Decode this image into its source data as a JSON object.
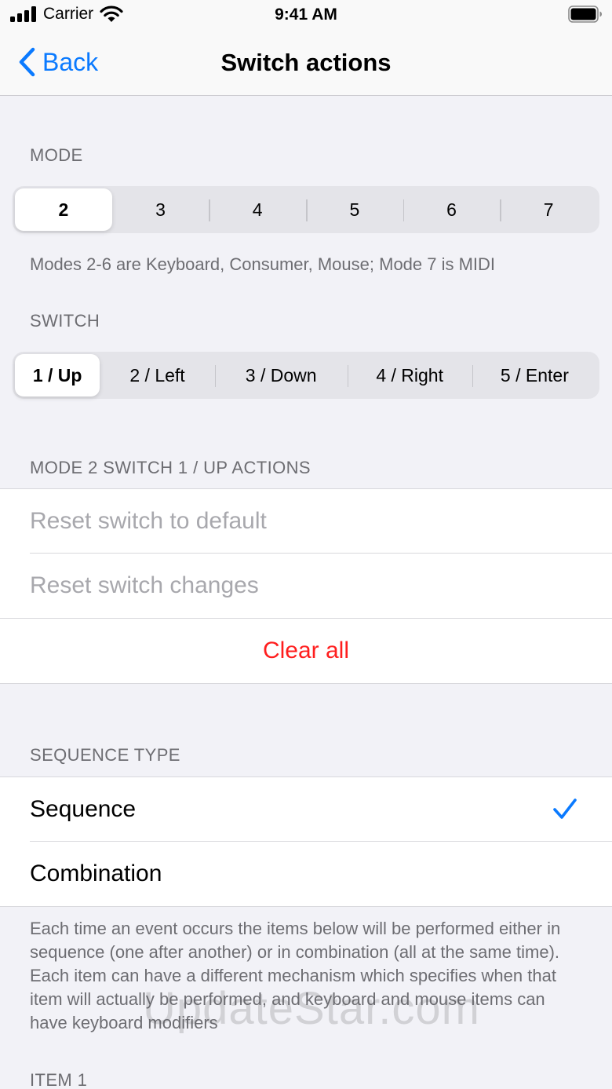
{
  "status": {
    "carrier": "Carrier",
    "time": "9:41 AM"
  },
  "nav": {
    "back_label": "Back",
    "title": "Switch actions"
  },
  "mode": {
    "header": "MODE",
    "options": [
      "2",
      "3",
      "4",
      "5",
      "6",
      "7"
    ],
    "selected": "2",
    "footnote": "Modes 2-6 are Keyboard, Consumer, Mouse; Mode 7 is MIDI"
  },
  "switch": {
    "header": "SWITCH",
    "options": [
      "1 / Up",
      "2 / Left",
      "3 / Down",
      "4 / Right",
      "5 / Enter"
    ],
    "selected": "1 / Up"
  },
  "actions": {
    "header": "MODE 2 SWITCH 1 / UP ACTIONS",
    "reset_default": "Reset switch to default",
    "reset_changes": "Reset switch changes",
    "clear_all": "Clear all"
  },
  "sequence_type": {
    "header": "SEQUENCE TYPE",
    "options": [
      "Sequence",
      "Combination"
    ],
    "selected": "Sequence",
    "footnote": "Each time an event occurs the items below will be performed either in sequence (one after another) or in combination (all at the same time). Each item can have a different mechanism which specifies when that item will actually be performed, and keyboard and mouse items can have keyboard modifiers"
  },
  "item1": {
    "header": "ITEM 1"
  },
  "watermark": "UpdateStar.com",
  "colors": {
    "accent": "#0a7aff",
    "destructive": "#ff1e1e",
    "background": "#f2f2f7"
  },
  "icons": [
    "cellular-signal-icon",
    "wifi-icon",
    "battery-icon",
    "chevron-left-icon",
    "checkmark-icon"
  ]
}
